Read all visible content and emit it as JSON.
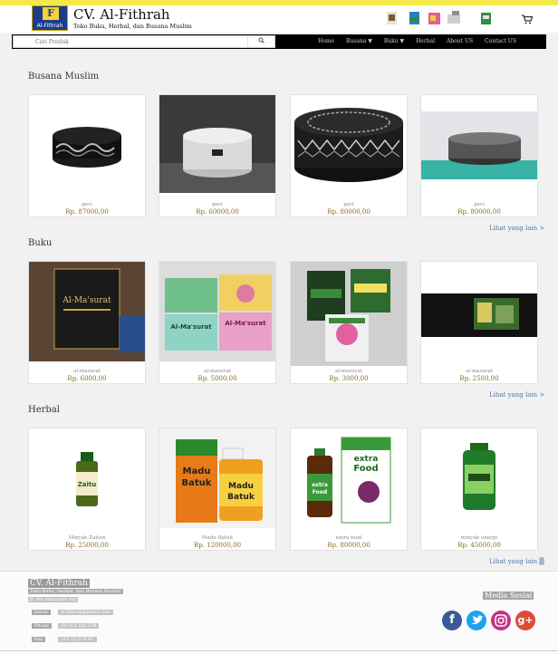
{
  "header": {
    "logo_letter": "F",
    "logo_text": "Al-Fithrah",
    "brand": "CV. Al-Fithrah",
    "tagline": "Toko Buku, Herbal, dan Busana Muslim"
  },
  "search": {
    "placeholder": "Cari Produk"
  },
  "nav": {
    "items": [
      "Home",
      "Busana ▼",
      "Buku ▼",
      "Herbal",
      "About US",
      "Contact US"
    ]
  },
  "sections": [
    {
      "title": "Busana Muslim",
      "more": "Lihat yang lain >",
      "products": [
        {
          "name": "peci",
          "price": "Rp. 87000,00"
        },
        {
          "name": "peci",
          "price": "Rp. 60000,00"
        },
        {
          "name": "peci",
          "price": "Rp. 80000,00"
        },
        {
          "name": "peci",
          "price": "Rp. 80000,00"
        }
      ]
    },
    {
      "title": "Buku",
      "more": "Lihat yang lain >",
      "products": [
        {
          "name": "al-masurat",
          "price": "Rp. 6000,00"
        },
        {
          "name": "al-masurat",
          "price": "Rp. 5000,00"
        },
        {
          "name": "al-masurat",
          "price": "Rp. 3000,00"
        },
        {
          "name": "al-masurat",
          "price": "Rp. 2500,00"
        }
      ]
    },
    {
      "title": "Herbal",
      "more": "Lihat yang lain ▒",
      "products": [
        {
          "name": "Minyak Zaitun",
          "price": "Rp. 25000,00"
        },
        {
          "name": "Madu Batuk",
          "price": "Rp. 120000,00"
        },
        {
          "name": "extra food",
          "price": "Rp. 80000,00"
        },
        {
          "name": "minyak energi",
          "price": "Rp. 45000,00"
        }
      ]
    }
  ],
  "product_images": {
    "zaitun_label": "Zaitu",
    "madu_line1": "Madu",
    "madu_line2": "Batuk",
    "extra_line1": "extra",
    "extra_line2": "Food",
    "book_text": "Al-Ma'surat"
  },
  "footer": {
    "title": "CV. Al-Fithrah",
    "tagline": "Toko Buku, Herbal, dan Busana Muslim",
    "address": "Jl. xxx xxxx xxxx xxx",
    "contacts": [
      {
        "label": "Email",
        "value": "al-fithrah@gmail.com"
      },
      {
        "label": "Phone",
        "value": "(0) 821 xxx 234"
      },
      {
        "label": "Fax",
        "value": "518 22 529 81"
      }
    ],
    "media_title": "Media Sosial",
    "social": [
      "facebook-icon",
      "twitter-icon",
      "instagram-icon",
      "google-plus-icon"
    ]
  },
  "colors": {
    "nav_bg": "#000000",
    "top_strip": "#f5e94a",
    "price": "#8a6d1a",
    "link": "#5577aa"
  }
}
